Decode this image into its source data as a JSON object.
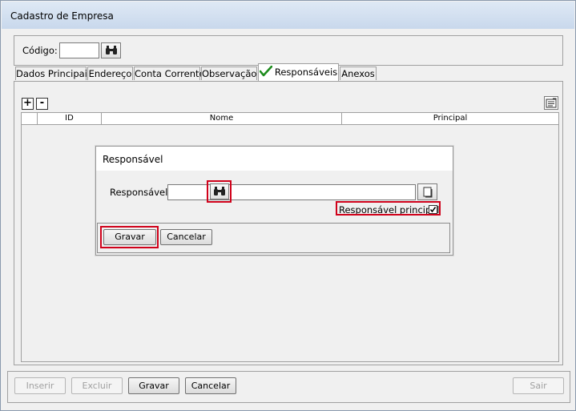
{
  "window": {
    "title": "Cadastro de Empresa"
  },
  "header": {
    "codigo_label": "Código:",
    "codigo_value": ""
  },
  "tabs": [
    {
      "label": "Dados Principais"
    },
    {
      "label": "Endereço"
    },
    {
      "label": "Conta Corrente"
    },
    {
      "label": "Observação"
    },
    {
      "label": "Responsáveis",
      "active": true,
      "status_icon": "check-icon"
    },
    {
      "label": "Anexos"
    }
  ],
  "grid": {
    "add_label": "+",
    "remove_label": "-",
    "columns": [
      "ID",
      "Nome",
      "Principal"
    ],
    "rows": []
  },
  "dialog": {
    "title": "Responsável",
    "field_label": "Responsável :",
    "field_value": "",
    "checkbox_label": "Responsável principal",
    "checkbox_checked": true,
    "save_label": "Gravar",
    "cancel_label": "Cancelar"
  },
  "footer": {
    "insert_label": "Inserir",
    "delete_label": "Excluir",
    "save_label": "Gravar",
    "cancel_label": "Cancelar",
    "exit_label": "Sair"
  },
  "colors": {
    "highlight": "#d0021b",
    "check": "#1e8c1e"
  }
}
